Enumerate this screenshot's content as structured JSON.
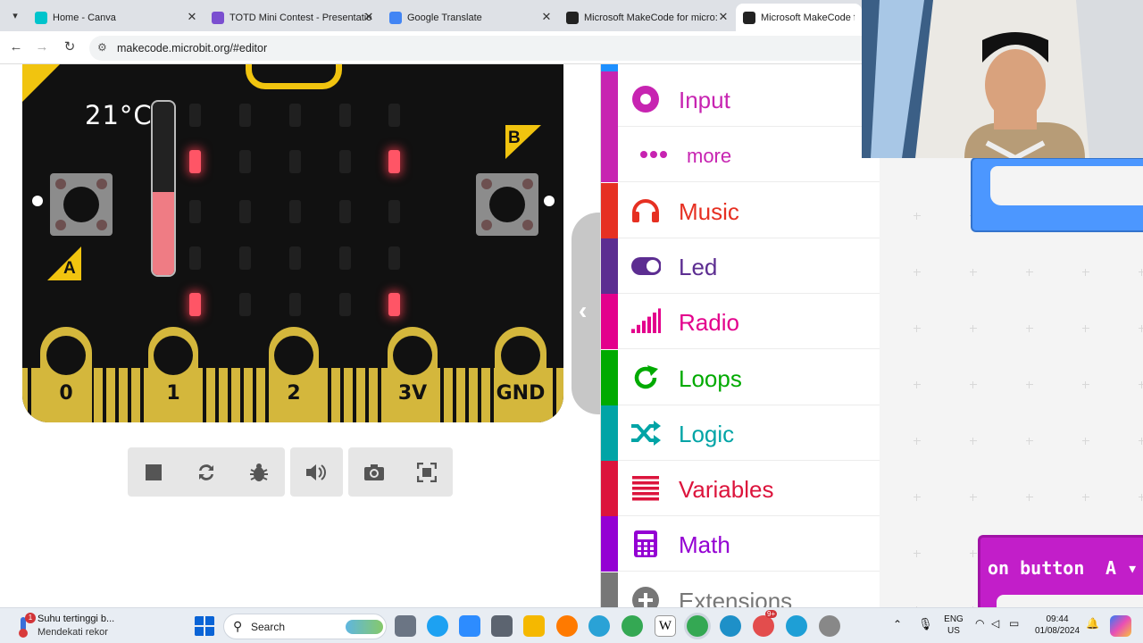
{
  "browser": {
    "tabs": [
      {
        "label": "Home - Canva",
        "favicon": "canva-icon",
        "color": "#00c4cc",
        "active": false
      },
      {
        "label": "TOTD Mini Contest - Presentatio",
        "favicon": "presentation-icon",
        "color": "#7b4fd0",
        "active": false
      },
      {
        "label": "Google Translate",
        "favicon": "google-translate-icon",
        "color": "#4285f4",
        "active": false
      },
      {
        "label": "Microsoft MakeCode for micro:",
        "favicon": "makecode-icon",
        "color": "#222222",
        "active": false
      },
      {
        "label": "Microsoft MakeCode for m",
        "favicon": "makecode-icon",
        "color": "#222222",
        "active": true
      }
    ],
    "close_glyph": "✕",
    "url": "makecode.microbit.org/#editor"
  },
  "simulator": {
    "temperature": "21°C",
    "thermometer_level": 0.48,
    "button_a": "A",
    "button_b": "B",
    "pins": [
      "0",
      "1",
      "2",
      "3V",
      "GND"
    ],
    "leds": [
      [
        0,
        0,
        0,
        0,
        0
      ],
      [
        1,
        0,
        0,
        0,
        1
      ],
      [
        0,
        0,
        0,
        0,
        0
      ],
      [
        0,
        0,
        0,
        0,
        0
      ],
      [
        1,
        0,
        0,
        0,
        1
      ]
    ],
    "controls": [
      "stop-icon",
      "restart-icon",
      "debug-icon",
      "mute-icon",
      "screenshot-icon",
      "fullscreen-icon"
    ]
  },
  "toolbox": {
    "categories": [
      {
        "label": "Input",
        "color": "#c724b1",
        "icon": "input-icon"
      },
      {
        "label": "more",
        "color": "#c724b1",
        "icon": "more-icon",
        "sub": true
      },
      {
        "label": "Music",
        "color": "#e63022",
        "icon": "headphones-icon"
      },
      {
        "label": "Led",
        "color": "#5c2d91",
        "icon": "toggle-icon"
      },
      {
        "label": "Radio",
        "color": "#e3008c",
        "icon": "signal-icon"
      },
      {
        "label": "Loops",
        "color": "#00aa00",
        "icon": "loop-icon"
      },
      {
        "label": "Logic",
        "color": "#00a4a6",
        "icon": "shuffle-icon"
      },
      {
        "label": "Variables",
        "color": "#dc143c",
        "icon": "list-icon"
      },
      {
        "label": "Math",
        "color": "#9400d3",
        "icon": "calculator-icon"
      },
      {
        "label": "Extensions",
        "color": "#777777",
        "icon": "plus-icon"
      }
    ]
  },
  "workspace": {
    "event_block_text": "on button",
    "event_block_dropdown": "A ▾"
  },
  "taskbar": {
    "weather_title": "Suhu tertinggi b...",
    "weather_subtitle": "Mendekati rekor",
    "weather_badge": "1",
    "search_label": "Search",
    "lang_top": "ENG",
    "lang_bottom": "US",
    "time": "09:44",
    "date": "01/08/2024",
    "notification_badge": "9+"
  }
}
